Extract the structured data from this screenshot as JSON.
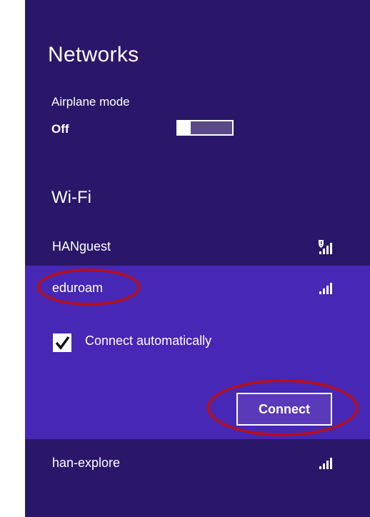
{
  "header": {
    "title": "Networks"
  },
  "airplane_mode": {
    "label": "Airplane mode",
    "state": "Off"
  },
  "wifi": {
    "heading": "Wi-Fi",
    "networks": [
      {
        "name": "HANguest",
        "icon": "secured-signal-icon",
        "selected": false
      },
      {
        "name": "eduroam",
        "icon": "signal-bars-icon",
        "selected": true
      },
      {
        "name": "han-explore",
        "icon": "signal-bars-icon",
        "selected": false
      }
    ]
  },
  "selected_network": {
    "connect_automatically_label": "Connect automatically",
    "connect_automatically_checked": true,
    "connect_button": "Connect"
  },
  "colors": {
    "panel_bg": "#2a1769",
    "selected_bg": "#4627b6",
    "annotation_red": "#b3101e"
  }
}
